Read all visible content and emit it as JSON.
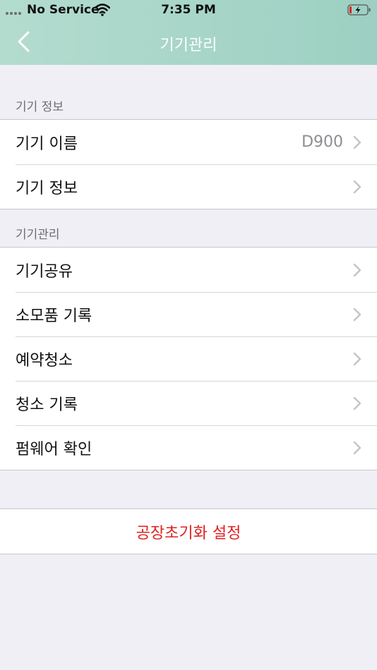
{
  "status_bar": {
    "carrier": "No Service",
    "time": "7:35 PM"
  },
  "nav": {
    "title": "기기관리"
  },
  "sections": [
    {
      "header": "기기 정보",
      "rows": [
        {
          "label": "기기 이름",
          "value": "D900"
        },
        {
          "label": "기기 정보",
          "value": ""
        }
      ]
    },
    {
      "header": "기기관리",
      "rows": [
        {
          "label": "기기공유"
        },
        {
          "label": "소모품 기록"
        },
        {
          "label": "예약청소"
        },
        {
          "label": "청소 기록"
        },
        {
          "label": "펌웨어 확인"
        }
      ]
    }
  ],
  "reset": {
    "label": "공장초기화 설정"
  },
  "colors": {
    "header_start": "#b3dccf",
    "header_end": "#9dd0c2",
    "background": "#f0eff5",
    "destructive": "#e02020",
    "secondary_text": "#8e8e93"
  },
  "icons": [
    "signal-dots-icon",
    "wifi-icon",
    "battery-charging-icon",
    "back-chevron-icon",
    "chevron-right-icon"
  ]
}
